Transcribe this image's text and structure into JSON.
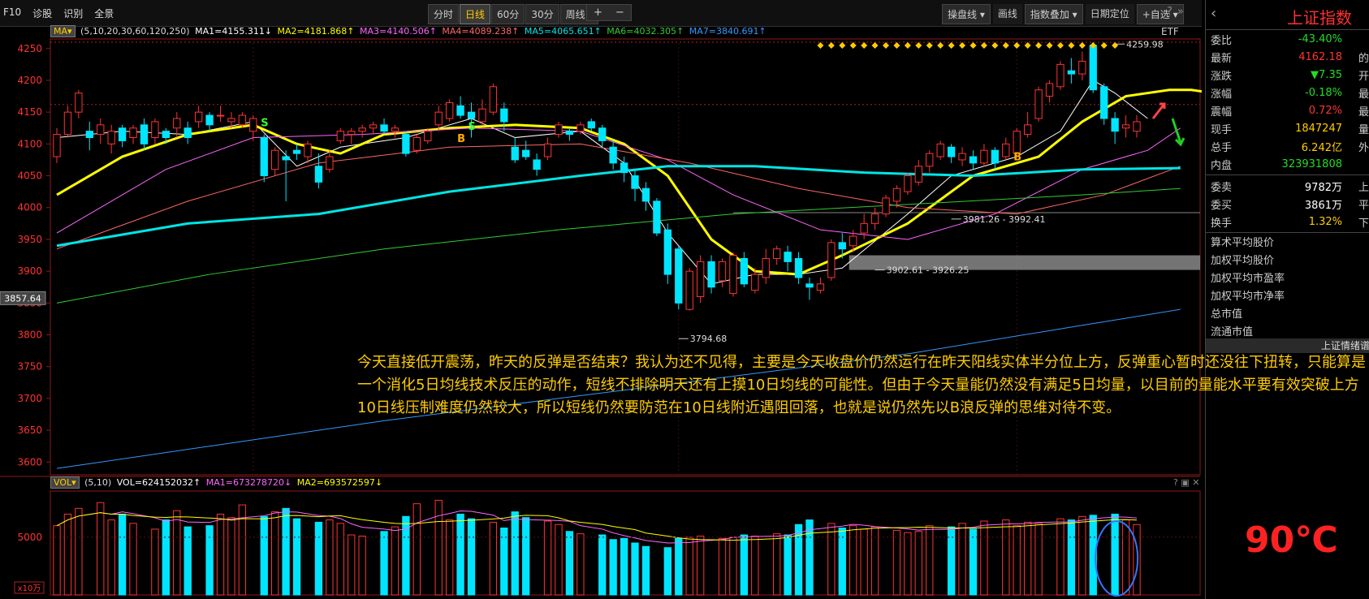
{
  "toolbar": {
    "left": [
      "F10",
      "诊股",
      "识别",
      "全景"
    ],
    "periods": [
      "分时",
      "日线",
      "60分",
      "30分",
      "周线 ▾"
    ],
    "active_period": "日线",
    "zoom_in": "+",
    "zoom_out": "−",
    "right": [
      "操盘线 ▾",
      "画线",
      "指数叠加 ▾",
      "日期定位",
      "+自选 ▾"
    ],
    "icons": [
      "?",
      "»"
    ]
  },
  "ma_legend": {
    "tag": "MA▾",
    "params": "(5,10,20,30,60,120,250)",
    "ma1": "MA1=4155.311↓",
    "ma2": "MA2=4181.868↑",
    "ma3": "MA3=4140.506↑",
    "ma4": "MA4=4089.238↑",
    "ma5": "MA5=4065.651↑",
    "ma6": "MA6=4032.305↑",
    "ma7": "MA7=3840.691↑"
  },
  "etf": "ETF",
  "vol_legend": {
    "tag": "VOL▾",
    "params": "(5,10)",
    "vol": "VOL=624152032↑",
    "ma1": "MA1=673278720↓",
    "ma2": "MA2=693572597↓"
  },
  "vol_icons": "? ▣ ✕",
  "annotation": "今天直接低开震荡，昨天的反弹是否结束？我认为还不见得，主要是今天收盘价仍然运行在昨天阳线实体半分位上方，反弹重心暂时还没往下扭转，只能算是一个消化5日均线技术反压的动作，短线不排除明天还有上摸10日均线的可能性。但由于今天量能仍然没有满足5日均量，以目前的量能水平要有效突破上方10日线压制难度仍然较大，所以短线仍然要防范在10日线附近遇阻回落，也就是说仍然先以B浪反弹的思维对待不变。",
  "right_panel": {
    "title": "上证指数",
    "rows": [
      {
        "label": "委比",
        "value": "-43.40%",
        "color": "#22dd22",
        "cut": ""
      },
      {
        "label": "最新",
        "value": "4162.18",
        "color": "#ff3333",
        "cut": "的"
      },
      {
        "label": "涨跌",
        "value": "▼7.35",
        "color": "#22dd22",
        "cut": "开"
      },
      {
        "label": "涨幅",
        "value": "-0.18%",
        "color": "#22dd22",
        "cut": "最"
      },
      {
        "label": "震幅",
        "value": "0.72%",
        "color": "#ff3333",
        "cut": "最"
      },
      {
        "label": "现手",
        "value": "1847247",
        "color": "#ffcc00",
        "cut": "量"
      },
      {
        "label": "总手",
        "value": "6.242亿",
        "color": "#ffcc00",
        "cut": "外"
      },
      {
        "label": "内盘",
        "value": "323931808",
        "color": "#22dd22",
        "cut": ""
      }
    ],
    "rows2": [
      {
        "label": "委卖",
        "value": "9782万",
        "color": "#ffffff",
        "cut": "上"
      },
      {
        "label": "委买",
        "value": "3861万",
        "color": "#ffffff",
        "cut": "平"
      },
      {
        "label": "换手",
        "value": "1.32%",
        "color": "#ffcc00",
        "cut": "下"
      }
    ],
    "items": [
      "算术平均股价",
      "加权平均股价",
      "加权平均市盈率",
      "加权平均市净率",
      "总市值",
      "流通市值"
    ],
    "bar_label": "上证情绪谱",
    "temperature": "90℃"
  },
  "chart_data": {
    "type": "candlestick",
    "ylim": [
      3580,
      4265
    ],
    "yticks": [
      4250,
      4200,
      4150,
      4100,
      4050,
      4000,
      3950,
      3900,
      3850,
      3800,
      3750,
      3700,
      3650,
      3600
    ],
    "current_price_label": "3857.64",
    "candles": [
      [
        4080,
        4115,
        4070,
        4125
      ],
      [
        4115,
        4150,
        4110,
        4160
      ],
      [
        4150,
        4180,
        4140,
        4185
      ],
      [
        4120,
        4110,
        4090,
        4135
      ],
      [
        4115,
        4130,
        4100,
        4140
      ],
      [
        4100,
        4120,
        4085,
        4130
      ],
      [
        4125,
        4105,
        4095,
        4130
      ],
      [
        4110,
        4125,
        4100,
        4130
      ],
      [
        4130,
        4100,
        4090,
        4140
      ],
      [
        4110,
        4135,
        4100,
        4140
      ],
      [
        4120,
        4110,
        4100,
        4125
      ],
      [
        4125,
        4140,
        4110,
        4150
      ],
      [
        4125,
        4110,
        4100,
        4135
      ],
      [
        4135,
        4150,
        4125,
        4160
      ],
      [
        4145,
        4130,
        4120,
        4150
      ],
      [
        4145,
        4145,
        4135,
        4160
      ],
      [
        4135,
        4140,
        4125,
        4150
      ],
      [
        4130,
        4145,
        4125,
        4150
      ],
      [
        4120,
        4140,
        4105,
        4145
      ],
      [
        4110,
        4050,
        4040,
        4115
      ],
      [
        4060,
        4090,
        4050,
        4095
      ],
      [
        4080,
        4075,
        4010,
        4090
      ],
      [
        4090,
        4085,
        4075,
        4100
      ],
      [
        4080,
        4100,
        4070,
        4105
      ],
      [
        4065,
        4040,
        4030,
        4085
      ],
      [
        4060,
        4080,
        4055,
        4090
      ],
      [
        4105,
        4120,
        4100,
        4125
      ],
      [
        4115,
        4120,
        4100,
        4125
      ],
      [
        4120,
        4125,
        4110,
        4130
      ],
      [
        4125,
        4130,
        4115,
        4135
      ],
      [
        4130,
        4120,
        4115,
        4140
      ],
      [
        4120,
        4125,
        4110,
        4130
      ],
      [
        4115,
        4085,
        4080,
        4120
      ],
      [
        4090,
        4110,
        4085,
        4115
      ],
      [
        4105,
        4120,
        4100,
        4125
      ],
      [
        4130,
        4150,
        4120,
        4160
      ],
      [
        4140,
        4165,
        4135,
        4170
      ],
      [
        4160,
        4145,
        4140,
        4175
      ],
      [
        4150,
        4140,
        4110,
        4165
      ],
      [
        4135,
        4155,
        4130,
        4170
      ],
      [
        4150,
        4190,
        4145,
        4195
      ],
      [
        4155,
        4135,
        4120,
        4165
      ],
      [
        4095,
        4075,
        4070,
        4110
      ],
      [
        4090,
        4080,
        4075,
        4105
      ],
      [
        4075,
        4060,
        4050,
        4085
      ],
      [
        4080,
        4100,
        4075,
        4110
      ],
      [
        4115,
        4130,
        4110,
        4135
      ],
      [
        4120,
        4115,
        4105,
        4125
      ],
      [
        4120,
        4130,
        4115,
        4135
      ],
      [
        4135,
        4125,
        4120,
        4140
      ],
      [
        4125,
        4105,
        4095,
        4130
      ],
      [
        4095,
        4070,
        4060,
        4105
      ],
      [
        4070,
        4055,
        4040,
        4080
      ],
      [
        4050,
        4030,
        4010,
        4060
      ],
      [
        4030,
        4010,
        3995,
        4040
      ],
      [
        4010,
        3960,
        3955,
        4015
      ],
      [
        3965,
        3895,
        3880,
        3975
      ],
      [
        3935,
        3850,
        3840,
        3940
      ],
      [
        3840,
        3900,
        3838,
        3905
      ],
      [
        3860,
        3915,
        3850,
        3925
      ],
      [
        3915,
        3875,
        3865,
        3925
      ],
      [
        3885,
        3915,
        3875,
        3920
      ],
      [
        3865,
        3925,
        3860,
        3930
      ],
      [
        3920,
        3880,
        3875,
        3930
      ],
      [
        3870,
        3895,
        3865,
        3905
      ],
      [
        3890,
        3920,
        3880,
        3935
      ],
      [
        3920,
        3935,
        3910,
        3940
      ],
      [
        3930,
        3915,
        3900,
        3940
      ],
      [
        3920,
        3890,
        3880,
        3930
      ],
      [
        3880,
        3875,
        3855,
        3890
      ],
      [
        3870,
        3880,
        3865,
        3890
      ],
      [
        3890,
        3945,
        3885,
        3950
      ],
      [
        3945,
        3935,
        3920,
        3960
      ],
      [
        3940,
        3955,
        3930,
        3965
      ],
      [
        3960,
        3975,
        3950,
        3990
      ],
      [
        3975,
        3990,
        3965,
        4000
      ],
      [
        3990,
        4015,
        3985,
        4020
      ],
      [
        4010,
        4030,
        4000,
        4035
      ],
      [
        4025,
        4050,
        4020,
        4055
      ],
      [
        4040,
        4065,
        4035,
        4075
      ],
      [
        4065,
        4085,
        4055,
        4090
      ],
      [
        4080,
        4100,
        4075,
        4105
      ],
      [
        4095,
        4080,
        4070,
        4100
      ],
      [
        4075,
        4085,
        4065,
        4095
      ],
      [
        4080,
        4070,
        4060,
        4090
      ],
      [
        4070,
        4090,
        4065,
        4100
      ],
      [
        4090,
        4070,
        4060,
        4095
      ],
      [
        4080,
        4100,
        4075,
        4110
      ],
      [
        4085,
        4120,
        4080,
        4125
      ],
      [
        4115,
        4130,
        4110,
        4150
      ],
      [
        4140,
        4185,
        4135,
        4190
      ],
      [
        4175,
        4195,
        4165,
        4200
      ],
      [
        4190,
        4225,
        4185,
        4230
      ],
      [
        4215,
        4210,
        4195,
        4235
      ],
      [
        4210,
        4230,
        4200,
        4245
      ],
      [
        4255,
        4185,
        4180,
        4260
      ],
      [
        4190,
        4140,
        4130,
        4195
      ],
      [
        4140,
        4120,
        4100,
        4150
      ],
      [
        4125,
        4130,
        4110,
        4145
      ],
      [
        4120,
        4135,
        4110,
        4145
      ]
    ],
    "ma_series": [
      {
        "name": "MA1",
        "color": "#ffffff",
        "width": 1,
        "points": [
          [
            0,
            4110
          ],
          [
            6,
            4120
          ],
          [
            12,
            4115
          ],
          [
            18,
            4135
          ],
          [
            22,
            4065
          ],
          [
            26,
            4095
          ],
          [
            32,
            4110
          ],
          [
            38,
            4140
          ],
          [
            42,
            4110
          ],
          [
            48,
            4120
          ],
          [
            52,
            4070
          ],
          [
            56,
            3960
          ],
          [
            60,
            3880
          ],
          [
            64,
            3895
          ],
          [
            68,
            3895
          ],
          [
            72,
            3905
          ],
          [
            78,
            3990
          ],
          [
            82,
            4050
          ],
          [
            88,
            4080
          ],
          [
            92,
            4120
          ],
          [
            95,
            4200
          ],
          [
            97,
            4180
          ],
          [
            100,
            4140
          ]
        ]
      },
      {
        "name": "MA2",
        "color": "#ffff00",
        "width": 3,
        "points": [
          [
            0,
            4020
          ],
          [
            6,
            4080
          ],
          [
            12,
            4115
          ],
          [
            18,
            4130
          ],
          [
            22,
            4100
          ],
          [
            26,
            4085
          ],
          [
            30,
            4115
          ],
          [
            36,
            4125
          ],
          [
            42,
            4130
          ],
          [
            48,
            4125
          ],
          [
            52,
            4100
          ],
          [
            56,
            4050
          ],
          [
            60,
            3950
          ],
          [
            64,
            3900
          ],
          [
            68,
            3895
          ],
          [
            72,
            3925
          ],
          [
            78,
            3975
          ],
          [
            84,
            4050
          ],
          [
            90,
            4080
          ],
          [
            94,
            4135
          ],
          [
            98,
            4175
          ],
          [
            102,
            4185
          ],
          [
            104,
            4185
          ],
          [
            106,
            4180
          ]
        ]
      },
      {
        "name": "MA3",
        "color": "#ff66ff",
        "width": 1,
        "points": [
          [
            0,
            3960
          ],
          [
            10,
            4060
          ],
          [
            18,
            4110
          ],
          [
            28,
            4115
          ],
          [
            38,
            4125
          ],
          [
            48,
            4120
          ],
          [
            56,
            4075
          ],
          [
            62,
            4020
          ],
          [
            70,
            3965
          ],
          [
            78,
            3950
          ],
          [
            86,
            3990
          ],
          [
            94,
            4060
          ],
          [
            100,
            4090
          ],
          [
            103,
            4125
          ]
        ]
      },
      {
        "name": "MA4",
        "color": "#ff6666",
        "width": 1,
        "points": [
          [
            0,
            3935
          ],
          [
            12,
            4010
          ],
          [
            24,
            4070
          ],
          [
            36,
            4095
          ],
          [
            48,
            4100
          ],
          [
            58,
            4070
          ],
          [
            68,
            4030
          ],
          [
            78,
            4000
          ],
          [
            88,
            3990
          ],
          [
            96,
            4020
          ],
          [
            103,
            4065
          ]
        ]
      },
      {
        "name": "MA5",
        "color": "#00e5e5",
        "width": 3,
        "points": [
          [
            0,
            3940
          ],
          [
            12,
            3975
          ],
          [
            24,
            3990
          ],
          [
            36,
            4025
          ],
          [
            48,
            4050
          ],
          [
            56,
            4065
          ],
          [
            64,
            4065
          ],
          [
            74,
            4055
          ],
          [
            84,
            4050
          ],
          [
            94,
            4060
          ],
          [
            103,
            4062
          ]
        ]
      },
      {
        "name": "MA6",
        "color": "#33cc33",
        "width": 1,
        "points": [
          [
            0,
            3850
          ],
          [
            14,
            3895
          ],
          [
            30,
            3935
          ],
          [
            46,
            3965
          ],
          [
            62,
            3990
          ],
          [
            78,
            4005
          ],
          [
            94,
            4020
          ],
          [
            103,
            4030
          ]
        ]
      },
      {
        "name": "MA7",
        "color": "#3399ff",
        "width": 1,
        "points": [
          [
            0,
            3590
          ],
          [
            14,
            3625
          ],
          [
            30,
            3665
          ],
          [
            46,
            3700
          ],
          [
            62,
            3735
          ],
          [
            78,
            3770
          ],
          [
            94,
            3815
          ],
          [
            103,
            3840
          ]
        ]
      }
    ],
    "labels": [
      {
        "text": "3794.68",
        "i": 57,
        "v": 3794
      },
      {
        "text": "3902.61 - 3926.25",
        "i": 75,
        "v": 3902
      },
      {
        "text": "3981.26 - 3992.41",
        "i": 82,
        "v": 3982
      },
      {
        "text": "4259.98",
        "i": 97,
        "v": 4257
      }
    ],
    "signals": [
      {
        "text": "S",
        "i": 19,
        "v": 4128,
        "color": "#33ff33"
      },
      {
        "text": "B",
        "i": 37,
        "v": 4103,
        "color": "#ffaa00"
      },
      {
        "text": "S",
        "i": 38,
        "v": 4122,
        "color": "#33ff33"
      },
      {
        "text": "B",
        "i": 88,
        "v": 4074,
        "color": "#ffaa00"
      }
    ],
    "resistance_line": {
      "from": 62,
      "v": 3992
    },
    "volume": {
      "ylabel": "5000",
      "xunit": "x10万",
      "values": [
        6,
        7,
        7.5,
        8,
        6.5,
        7,
        6.2,
        5.7,
        6.5,
        7.3,
        5.9,
        6,
        7,
        6.7,
        7.8,
        6.8,
        7.2,
        7.5,
        6.6,
        6.3,
        6.5,
        6.2,
        5.2,
        5.1,
        5.5,
        5.9,
        6.8,
        7.9,
        8.2,
        6.5,
        7,
        6.6,
        6.3,
        5.8,
        7.2,
        6.7,
        6.4,
        6.1,
        5.5,
        5.3,
        5.2,
        4.8,
        4.9,
        4.5,
        4.2,
        4.1,
        4.9,
        5,
        5.1,
        4.9,
        5,
        5.2,
        5.1,
        5.3,
        5.2,
        6.1,
        6.5,
        6.2,
        5.8,
        6,
        5.7,
        5.9,
        5.6,
        5.4,
        5.5,
        6,
        5.9,
        6.2,
        5.7,
        6.4,
        6.5,
        6,
        6.3,
        6.2,
        6.6,
        6.5,
        6.8,
        6.9,
        7,
        6.5,
        6.1
      ]
    },
    "future_arrows": [
      {
        "color": "#ff4444",
        "dir": "up"
      },
      {
        "color": "#22cc22",
        "dir": "down"
      }
    ]
  }
}
